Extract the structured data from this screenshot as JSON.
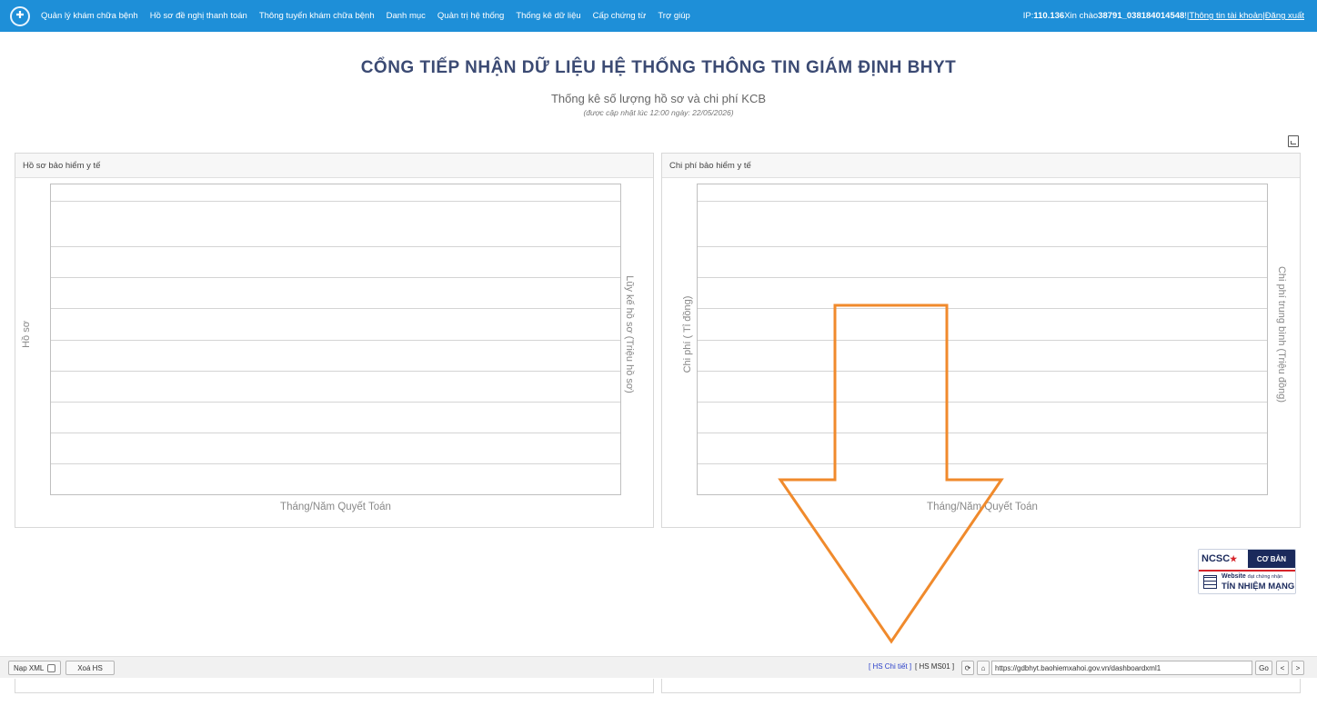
{
  "nav": {
    "logo": "logo-icon",
    "items": [
      "Quản lý khám chữa bệnh",
      "Hồ sơ đề nghị thanh toán",
      "Thông tuyến khám chữa bệnh",
      "Danh mục",
      "Quản trị hệ thống",
      "Thống kê dữ liệu",
      "Cấp chứng từ",
      "Trợ giúp"
    ]
  },
  "user": {
    "ip_label": "IP: ",
    "ip": "110.136",
    "greeting": " Xin chào",
    "username": "38791_038184014548",
    "sep1": " !|",
    "account_link": "Thông tin tài khoản",
    "sep2": " |",
    "logout_link": "Đăng xuất"
  },
  "page": {
    "title": "CỔNG TIẾP NHẬN DỮ LIỆU HỆ THỐNG THÔNG TIN GIÁM ĐỊNH BHYT",
    "subtitle": "Thống kê số lượng hồ sơ và chi phí KCB",
    "updated": "(được cập nhật lúc 12:00 ngày: 22/05/2026)"
  },
  "chart_data": [
    {
      "type": "line",
      "title": "Hồ sơ bảo hiểm y tế",
      "xlabel": "Tháng/Năm Quyết Toán",
      "ylabel": "Hồ sơ",
      "y2label": "Lũy kế hồ sơ (Triệu hồ sơ)",
      "series": [],
      "grid": true
    },
    {
      "type": "line",
      "title": "Chi phí bảo hiểm y tế",
      "xlabel": "Tháng/Năm Quyết Toán",
      "ylabel": "Chi phí ( Tỉ đồng)",
      "y2label": "Chi phí trung bình (Triệu đồng)",
      "series": [],
      "grid": true
    }
  ],
  "badge": {
    "org": "NCSC",
    "level": "CƠ BẢN",
    "website": "Website",
    "certified": "đạt chứng nhận",
    "trust": "TÍN NHIỆM MẠNG"
  },
  "bottombar": {
    "nap_xml": "Nạp XML",
    "xoa_hs": "Xoá HS",
    "hs_chitiet": "[ HS Chi tiết ]",
    "hs_ms01": "[ HS MS01 ]",
    "url": "https://gdbhyt.baohiemxahoi.gov.vn/dashboardxml1",
    "go": "Go",
    "prev": "<",
    "next": ">"
  },
  "colors": {
    "topbar": "#1e8fd8",
    "title": "#3b4a73",
    "arrow": "#f08a2c",
    "link": "#2a3fc9"
  }
}
